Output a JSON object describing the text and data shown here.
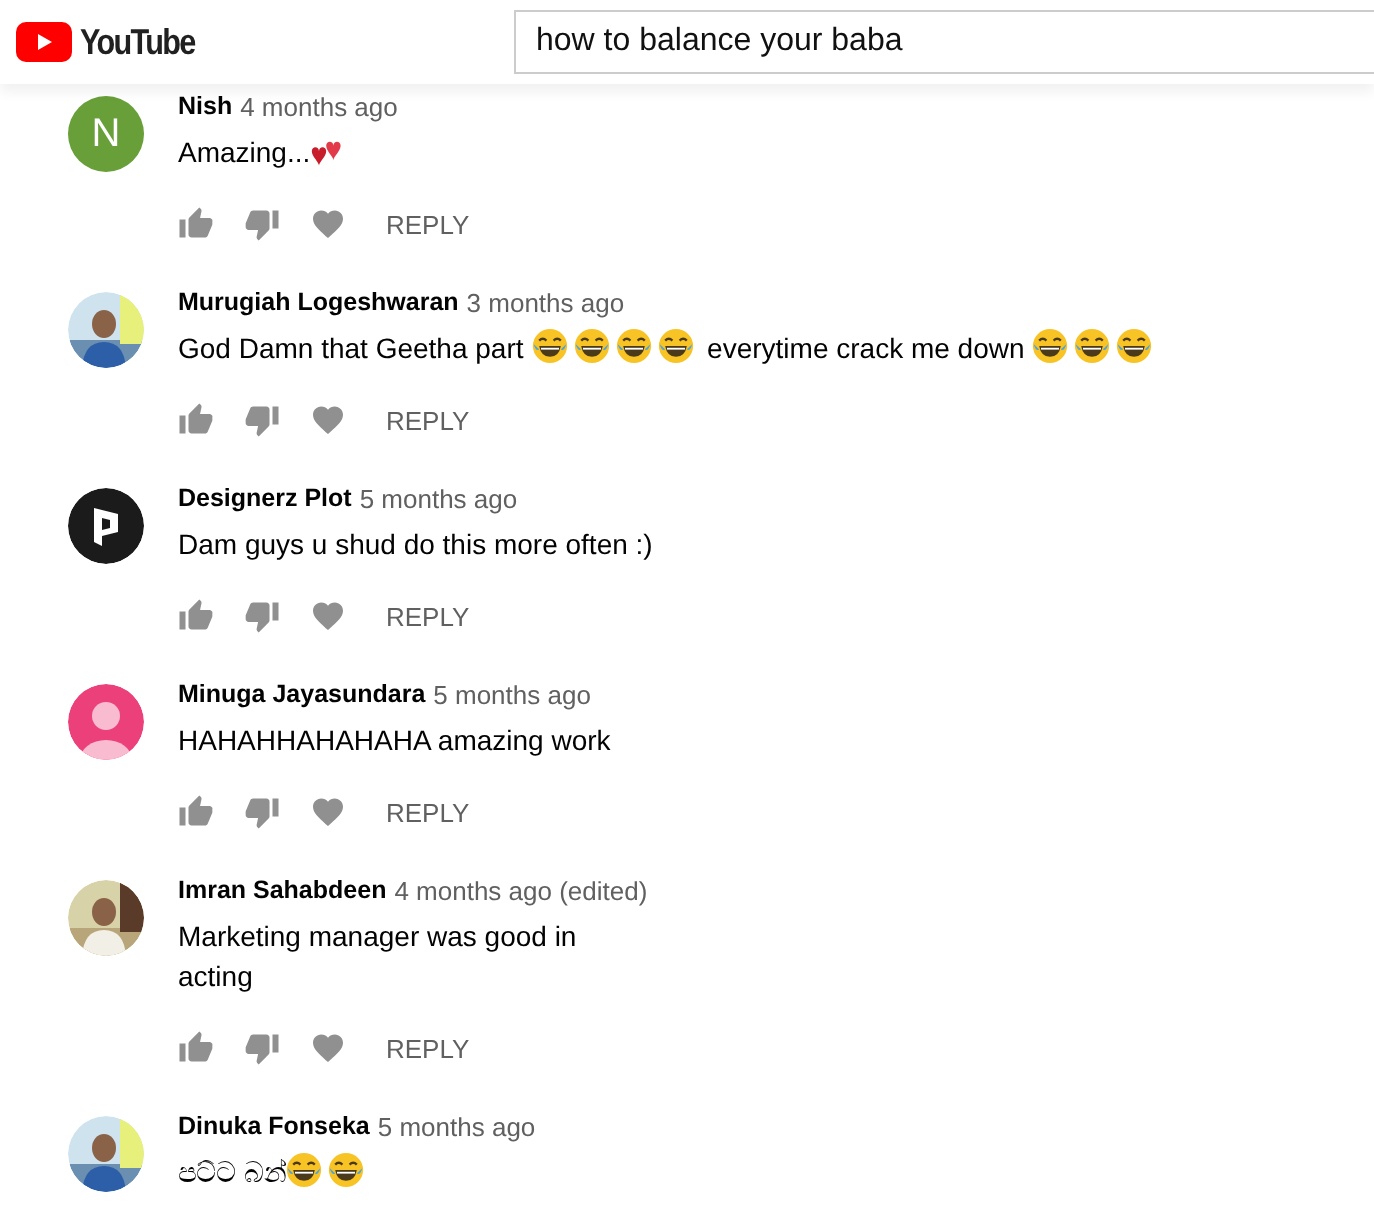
{
  "header": {
    "logo_text": "YouTube",
    "search": {
      "value": "how to balance your baba"
    }
  },
  "comments": [
    {
      "avatar": {
        "kind": "letter",
        "letter": "N",
        "color": "#689f38"
      },
      "author": "Nish",
      "time": "4 months ago",
      "text": [
        {
          "kind": "text",
          "text": "Amazing..."
        },
        {
          "kind": "hearts"
        }
      ],
      "actions": {
        "reply": "REPLY"
      }
    },
    {
      "author": "Murugiah Logeshwaran",
      "time": "3 months ago",
      "text": [
        {
          "kind": "text",
          "text": "God Damn that Geetha part "
        },
        {
          "kind": "laugh"
        },
        {
          "kind": "laugh"
        },
        {
          "kind": "laugh"
        },
        {
          "kind": "laugh"
        },
        {
          "kind": "text",
          "text": " everytime crack me down "
        },
        {
          "kind": "laugh"
        },
        {
          "kind": "laugh"
        },
        {
          "kind": "laugh"
        }
      ],
      "actions": {
        "reply": "REPLY"
      }
    },
    {
      "avatar": {
        "kind": "logo"
      },
      "author": "Designerz Plot",
      "time": "5 months ago",
      "text": [
        {
          "kind": "text",
          "text": "Dam guys u shud do this more often :)"
        }
      ],
      "actions": {
        "reply": "REPLY"
      }
    },
    {
      "avatar": {
        "kind": "default",
        "color": "#ec407a"
      },
      "author": "Minuga Jayasundara",
      "time": "5 months ago",
      "text": [
        {
          "kind": "text",
          "text": "HAHAHHAHAHAHA amazing work"
        }
      ],
      "actions": {
        "reply": "REPLY"
      }
    },
    {
      "author": "Imran Sahabdeen",
      "time": "4 months ago (edited)",
      "text": [
        {
          "kind": "text",
          "text": "Marketing manager was good in"
        },
        {
          "kind": "break"
        },
        {
          "kind": "text",
          "text": "acting"
        }
      ],
      "actions": {
        "reply": "REPLY"
      }
    },
    {
      "author": "Dinuka Fonseka",
      "time": "5 months ago",
      "text": [
        {
          "kind": "text",
          "text": "පට්ට බන්"
        },
        {
          "kind": "laugh"
        },
        {
          "kind": "laugh"
        }
      ]
    }
  ]
}
